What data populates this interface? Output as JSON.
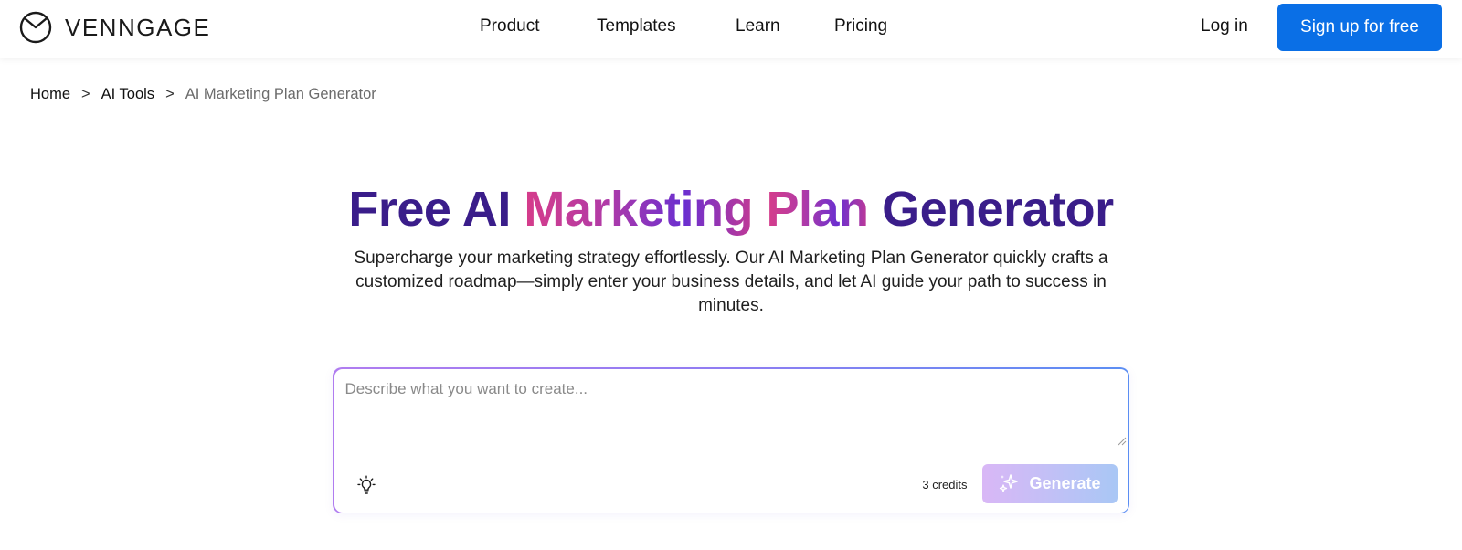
{
  "header": {
    "logo_text": "VENNGAGE",
    "logo_icon": "venngage-logo-icon",
    "nav": [
      {
        "label": "Product"
      },
      {
        "label": "Templates"
      },
      {
        "label": "Learn"
      },
      {
        "label": "Pricing"
      }
    ],
    "login_label": "Log in",
    "signup_label": "Sign up for free"
  },
  "breadcrumb": {
    "items": [
      {
        "label": "Home"
      },
      {
        "label": "AI Tools"
      }
    ],
    "separator": ">",
    "current": "AI Marketing Plan Generator"
  },
  "hero": {
    "title_parts": [
      "Free AI",
      "Marketing",
      "Plan",
      "Generator"
    ],
    "subtitle": "Supercharge your marketing strategy effortlessly. Our AI Marketing Plan Generator quickly crafts a customized roadmap—simply enter your business details, and let AI guide your path to success in minutes."
  },
  "prompt": {
    "placeholder": "Describe what you want to create...",
    "value": "",
    "idea_icon": "lightbulb-icon",
    "credits_text": "3 credits",
    "generate_label": "Generate",
    "generate_icon": "sparkle-icon"
  },
  "colors": {
    "brand_blue": "#0a6fe6",
    "title_purple": "#3a1d8a",
    "gradient_pink": "#d63c8a",
    "gradient_violet": "#6a2fd0"
  }
}
